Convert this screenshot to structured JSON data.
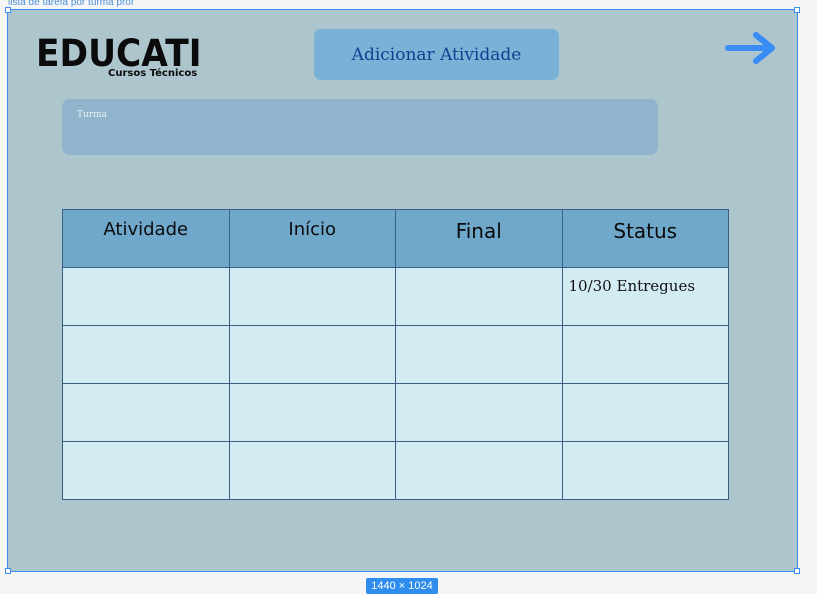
{
  "frame": {
    "label": "lista de tarefa por turma prof",
    "dimensions": "1440 × 1024"
  },
  "logo": {
    "main": "EDUCATI",
    "subtitle": "Cursos Técnicos"
  },
  "toolbar": {
    "add_activity_label": "Adicionar Atividade",
    "next_icon": "arrow-right-icon"
  },
  "turma_field": {
    "label": "Turma",
    "value": ""
  },
  "table": {
    "headers": [
      "Atividade",
      "Início",
      "Final",
      "Status"
    ],
    "rows": [
      [
        "",
        "",
        "",
        "10/30 Entregues"
      ],
      [
        "",
        "",
        "",
        ""
      ],
      [
        "",
        "",
        "",
        ""
      ],
      [
        "",
        "",
        "",
        ""
      ]
    ]
  },
  "colors": {
    "frame_background": "#adc5cd",
    "accent": "#3a8df5",
    "button_fill": "#79b2d6",
    "button_text": "#123f8f",
    "table_header": "#6fa8cb",
    "table_cell": "#d3ecf4"
  }
}
